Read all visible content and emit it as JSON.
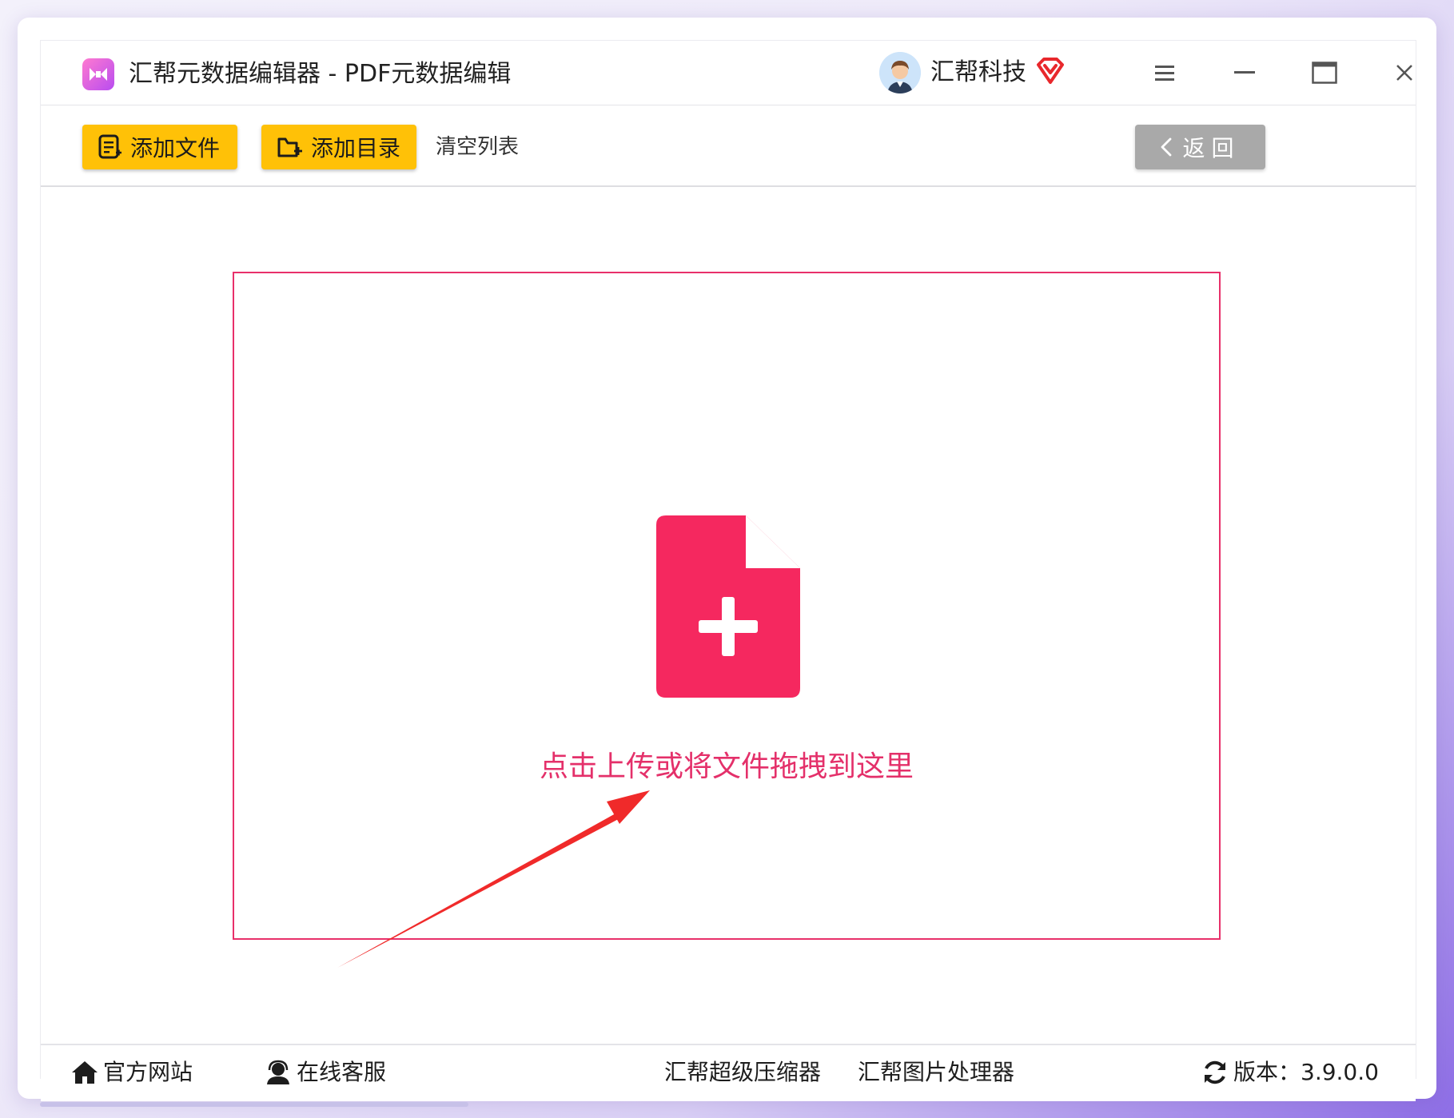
{
  "window": {
    "app_title": "汇帮元数据编辑器 - PDF元数据编辑",
    "company_name": "汇帮科技"
  },
  "toolbar": {
    "add_file": "添加文件",
    "add_dir": "添加目录",
    "clear_list": "清空列表",
    "back": "返回"
  },
  "dropzone": {
    "hint": "点击上传或将文件拖拽到这里"
  },
  "footer": {
    "official_site": "官方网站",
    "online_service": "在线客服",
    "compressor": "汇帮超级压缩器",
    "image_processor": "汇帮图片处理器",
    "version": "版本：3.9.0.0"
  },
  "colors": {
    "accent_yellow": "#ffc107",
    "drop_accent": "#f5285f",
    "arrow_red": "#f02a2a",
    "back_gray": "#a9a9a9"
  },
  "icons": {
    "app": "app-logo-icon",
    "vip": "vip-diamond-icon",
    "menu": "menu-icon",
    "minimize": "minimize-icon",
    "maximize": "maximize-icon",
    "close": "close-icon",
    "add_file": "add-file-icon",
    "add_dir": "add-folder-icon",
    "back": "chevron-left-icon",
    "file_plus": "file-plus-icon",
    "home": "home-icon",
    "service": "headset-icon",
    "refresh": "refresh-icon"
  }
}
